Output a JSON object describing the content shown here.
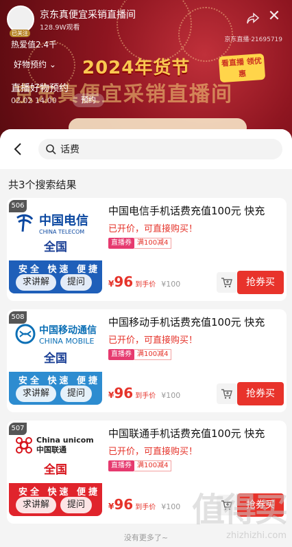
{
  "live": {
    "title": "京东真便宜采销直播间",
    "views": "128.9W观看",
    "follow": "已关注",
    "fans": "热爱值2.4千",
    "goods_preview": "好物预约 ⌄",
    "preview_label": "直播好物预约",
    "time": "02.02 14:00",
    "preview_btn": "预约",
    "room_id": "京东直播·21695719",
    "banner_title": "2024年货节",
    "banner_sub": "京东真便宜采销直播间",
    "badge": "看直播 领优惠"
  },
  "search": {
    "query": "话费"
  },
  "result_count": "共3个搜索结果",
  "products": [
    {
      "num": "506",
      "brand_cn": "中国电信",
      "brand_en": "CHINA TELECOM",
      "region": "全国",
      "stripe_text": "安全 快速 便捷",
      "brand_color": "#0a47a0",
      "stripe_color": "#1f5fb9",
      "explain_label": "求讲解",
      "ask_label": "提问",
      "title": "中国电信手机话费充值100元 快充",
      "status": "已开价，可直接购买！",
      "coupon": "直播券",
      "discount": "满100减4",
      "price_symbol": "¥",
      "price": "96",
      "price_label": "到手价",
      "orig_price": "¥100",
      "buy_label": "抢券买"
    },
    {
      "num": "508",
      "brand_cn": "中国移动通信",
      "brand_en": "CHINA MOBILE",
      "region": "全国",
      "stripe_text": "安全 快速 便捷",
      "brand_color": "#0b6fb5",
      "stripe_color": "#2d8cd0",
      "explain_label": "求讲解",
      "ask_label": "提问",
      "title": "中国移动手机话费充值100元 快充",
      "status": "已开价，可直接购买！",
      "coupon": "直播券",
      "discount": "满100减4",
      "price_symbol": "¥",
      "price": "96",
      "price_label": "到手价",
      "orig_price": "¥100",
      "buy_label": "抢券买"
    },
    {
      "num": "507",
      "brand_cn": "China unicom中国联通",
      "brand_en": "",
      "region": "全国",
      "stripe_text": "安全 快速 便捷",
      "brand_color": "#d7141c",
      "stripe_color": "#e0242c",
      "explain_label": "求讲解",
      "ask_label": "提问",
      "title": "中国联通手机话费充值100元 快充",
      "status": "已开价，可直接购买！",
      "coupon": "直播券",
      "discount": "满100减4",
      "price_symbol": "¥",
      "price": "96",
      "price_label": "到手价",
      "orig_price": "¥100",
      "buy_label": "抢券买"
    }
  ],
  "no_more": "没有更多了~",
  "watermark": {
    "big": "值得买",
    "small": "zhizhizhi.com"
  }
}
